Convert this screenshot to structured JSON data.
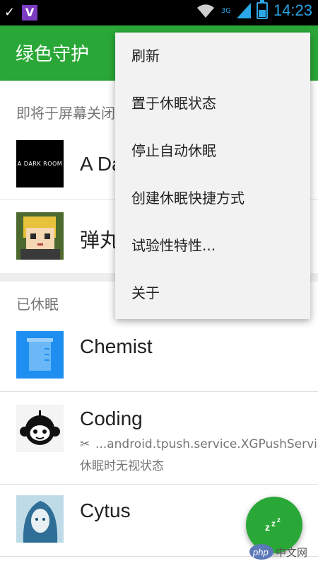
{
  "status_bar": {
    "time": "14:23",
    "network": "3G",
    "icons": [
      "check-icon",
      "v-app-icon",
      "wifi-icon",
      "signal-icon",
      "battery-icon"
    ]
  },
  "toolbar": {
    "title": "绿色守护"
  },
  "sections": {
    "pending_header": "即将于屏幕关闭",
    "hibernated_header": "已休眠"
  },
  "pending_apps": [
    {
      "name": "A Da",
      "icon": "dark-room-icon",
      "icon_text": "A DARK ROOM"
    },
    {
      "name": "弹丸",
      "icon": "pixel-anime-icon"
    }
  ],
  "hibernated_apps": [
    {
      "name": "Chemist",
      "icon": "beaker-icon"
    },
    {
      "name": "Coding",
      "icon": "monkey-icon",
      "sub1": "...android.tpush.service.XGPushServic",
      "sub2": "休眠时无视状态"
    },
    {
      "name": "Cytus",
      "icon": "cytus-girl-icon"
    }
  ],
  "menu": {
    "items": [
      {
        "label": "刷新"
      },
      {
        "label": "置于休眠状态"
      },
      {
        "label": "停止自动休眠"
      },
      {
        "label": "创建休眠快捷方式"
      },
      {
        "label": "试验性特性..."
      },
      {
        "label": "关于"
      }
    ]
  },
  "fab": {
    "icon": "zzz-icon"
  },
  "watermark": {
    "text": "php中文网"
  },
  "colors": {
    "primary": "#2aa837",
    "status_accent": "#2ba6e6",
    "menu_bg": "#f2f2f2"
  }
}
